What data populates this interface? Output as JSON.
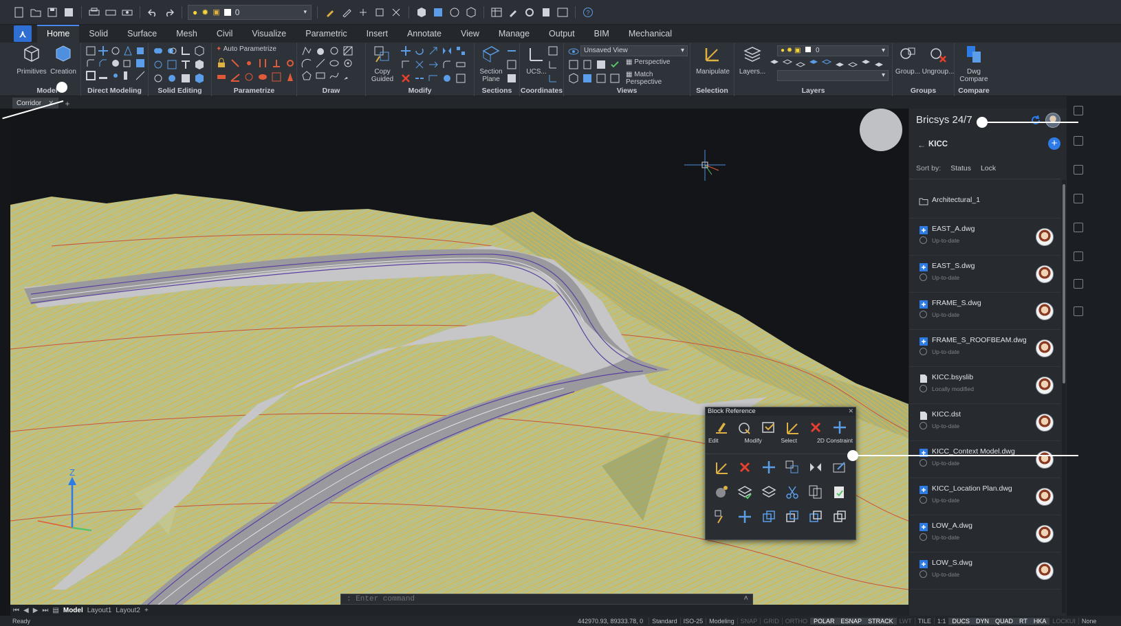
{
  "qat": {
    "layer_value": "0"
  },
  "tabs": [
    "Home",
    "Solid",
    "Surface",
    "Mesh",
    "Civil",
    "Visualize",
    "Parametric",
    "Insert",
    "Annotate",
    "View",
    "Manage",
    "Output",
    "BIM",
    "Mechanical"
  ],
  "ribbon": {
    "panels": {
      "model": "Model",
      "direct_modeling": "Direct Modeling",
      "solid_editing": "Solid Editing",
      "parametrize": "Parametrize",
      "draw": "Draw",
      "modify": "Modify",
      "sections": "Sections",
      "coordinates": "Coordinates",
      "views": "Views",
      "selection": "Selection",
      "layers": "Layers",
      "groups": "Groups",
      "compare": "Compare"
    },
    "buttons": {
      "primitives": "Primitives",
      "creation": "Creation",
      "auto_parametrize": "Auto Parametrize",
      "copy_guided": "Copy Guided",
      "section_plane": "Section Plane",
      "ucs": "UCS...",
      "view_combo": "Unsaved View",
      "perspective": "Perspective",
      "match_perspective": "Match Perspective",
      "manipulate": "Manipulate",
      "layers": "Layers...",
      "layer_combo": "0",
      "group": "Group...",
      "ungroup": "Ungroup...",
      "dwg_compare": "Dwg Compare"
    }
  },
  "doc_tab": "Corridor",
  "command_placeholder": ": Enter command",
  "layout_tabs": [
    "Model",
    "Layout1",
    "Layout2"
  ],
  "status": {
    "ready": "Ready",
    "coords": "442970.93, 89333.78, 0",
    "items": [
      {
        "label": "Standard",
        "state": "normal"
      },
      {
        "label": "ISO-25",
        "state": "normal"
      },
      {
        "label": "Modeling",
        "state": "normal"
      },
      {
        "label": "SNAP",
        "state": "off"
      },
      {
        "label": "GRID",
        "state": "off"
      },
      {
        "label": "ORTHO",
        "state": "off"
      },
      {
        "label": "POLAR",
        "state": "on"
      },
      {
        "label": "ESNAP",
        "state": "on"
      },
      {
        "label": "STRACK",
        "state": "on"
      },
      {
        "label": "LWT",
        "state": "off"
      },
      {
        "label": "TILE",
        "state": "normal"
      },
      {
        "label": "1:1",
        "state": "normal"
      },
      {
        "label": "DUCS",
        "state": "on"
      },
      {
        "label": "DYN",
        "state": "on"
      },
      {
        "label": "QUAD",
        "state": "on"
      },
      {
        "label": "RT",
        "state": "on"
      },
      {
        "label": "HKA",
        "state": "on"
      },
      {
        "label": "LOCKUI",
        "state": "off"
      },
      {
        "label": "None",
        "state": "normal"
      }
    ]
  },
  "panel": {
    "title": "Bricsys 24/7",
    "folder": "KICC",
    "sort_label": "Sort by:",
    "sort_status": "Status",
    "sort_lock": "Lock",
    "items": [
      {
        "name": "Architectural_1",
        "status": "",
        "kind": "folder"
      },
      {
        "name": "EAST_A.dwg",
        "status": "Up-to-date",
        "kind": "dwg"
      },
      {
        "name": "EAST_S.dwg",
        "status": "Up-to-date",
        "kind": "dwg"
      },
      {
        "name": "FRAME_S.dwg",
        "status": "Up-to-date",
        "kind": "dwg"
      },
      {
        "name": "FRAME_S_ROOFBEAM.dwg",
        "status": "Up-to-date",
        "kind": "dwg"
      },
      {
        "name": "KICC.bsyslib",
        "status": "Locally modified",
        "kind": "doc"
      },
      {
        "name": "KICC.dst",
        "status": "Up-to-date",
        "kind": "doc"
      },
      {
        "name": "KICC_Context Model.dwg",
        "status": "Up-to-date",
        "kind": "dwg"
      },
      {
        "name": "KICC_Location Plan.dwg",
        "status": "Up-to-date",
        "kind": "dwg"
      },
      {
        "name": "LOW_A.dwg",
        "status": "Up-to-date",
        "kind": "dwg"
      },
      {
        "name": "LOW_S.dwg",
        "status": "Up-to-date",
        "kind": "dwg"
      }
    ]
  },
  "quad": {
    "title": "Block Reference",
    "labels": [
      "Edit",
      "Modify",
      "Select",
      "2D Constraint"
    ]
  },
  "colors": {
    "accent": "#2f7be6",
    "terrain": "#b9c08a",
    "contour_yellow": "#e2b53a",
    "contour_red": "#c8523a",
    "road": "#9a9a9e",
    "road_edge": "#5a3fa0"
  }
}
